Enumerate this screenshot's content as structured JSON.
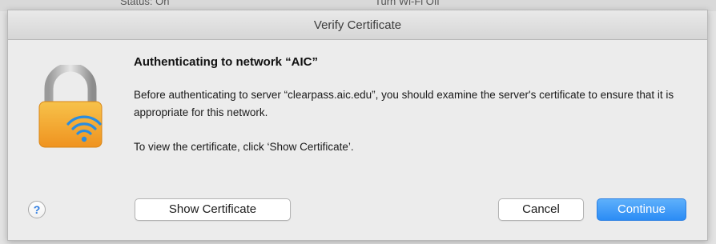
{
  "backdrop": {
    "fragment_left": "Status: On",
    "fragment_right": "Turn Wi-Fi Off"
  },
  "window": {
    "title": "Verify Certificate"
  },
  "dialog": {
    "heading": "Authenticating to network “AIC”",
    "message": "Before authenticating to server “clearpass.aic.edu”, you should examine the server's certificate to ensure that it is appropriate for this network.",
    "instruction": "To view the certificate, click ‘Show Certificate’.",
    "icon": "lock-wifi-icon"
  },
  "buttons": {
    "help_label": "?",
    "show_certificate_label": "Show Certificate",
    "cancel_label": "Cancel",
    "continue_label": "Continue"
  },
  "colors": {
    "accent": "#2b8cf5",
    "lock_gold": "#f3a83a",
    "wifi_blue": "#2a8de0"
  }
}
